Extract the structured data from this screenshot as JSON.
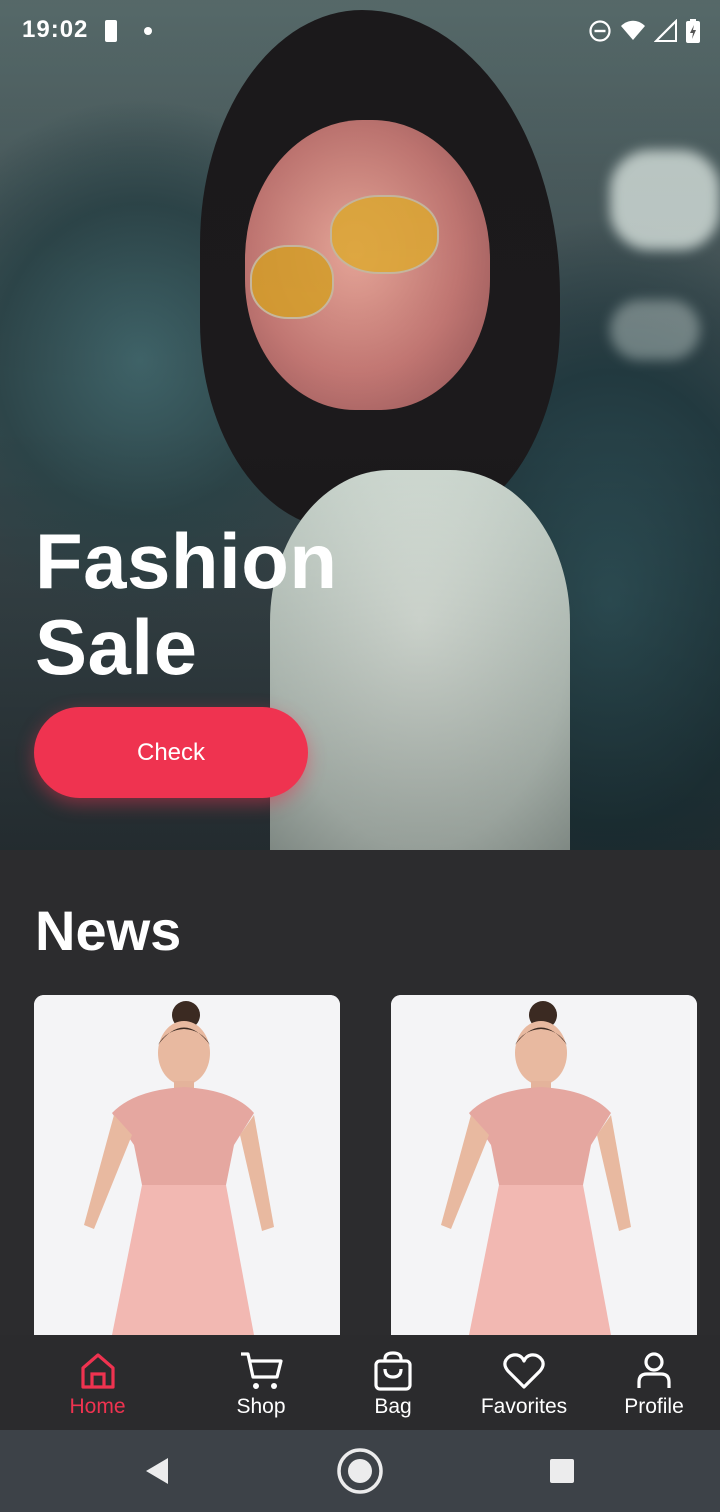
{
  "status_bar": {
    "time": "19:02",
    "icons": [
      "battery-saver-icon",
      "notification-dot-icon",
      "do-not-disturb-icon",
      "wifi-icon",
      "cell-signal-icon",
      "battery-charging-icon"
    ]
  },
  "hero": {
    "title_line1": "Fashion",
    "title_line2": "Sale",
    "button_label": "Check"
  },
  "news": {
    "title": "News",
    "cards": [
      {
        "image": "pink-lace-dress-photo"
      },
      {
        "image": "pink-lace-dress-photo"
      }
    ]
  },
  "bottom_nav": {
    "items": [
      {
        "label": "Home",
        "icon": "home-icon",
        "active": true
      },
      {
        "label": "Shop",
        "icon": "cart-icon",
        "active": false
      },
      {
        "label": "Bag",
        "icon": "bag-icon",
        "active": false
      },
      {
        "label": "Favorites",
        "icon": "heart-icon",
        "active": false
      },
      {
        "label": "Profile",
        "icon": "profile-icon",
        "active": false
      }
    ]
  },
  "system_nav": {
    "buttons": [
      "back-icon",
      "home-circle-icon",
      "recents-icon"
    ]
  },
  "colors": {
    "accent": "#ef3350",
    "background": "#2b2b2d",
    "system_nav": "#3d4248"
  }
}
